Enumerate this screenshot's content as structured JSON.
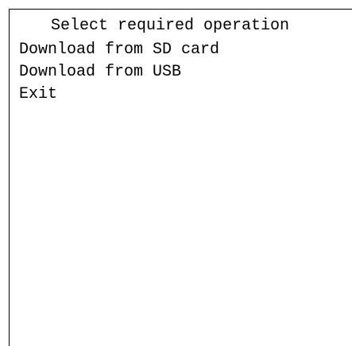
{
  "menu": {
    "title": "Select required operation",
    "items": [
      {
        "label": "Download from SD card"
      },
      {
        "label": "Download from USB"
      },
      {
        "label": "Exit"
      }
    ]
  }
}
